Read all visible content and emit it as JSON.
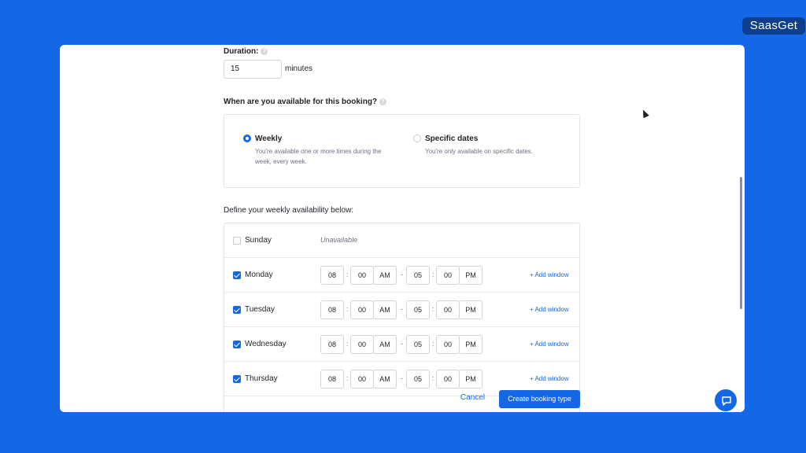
{
  "watermark": "SaasGet",
  "form": {
    "duration_label": "Duration:",
    "duration_value": "15",
    "duration_unit": "minutes",
    "availability_question": "When are you available for this booking?",
    "options": [
      {
        "title": "Weekly",
        "desc": "You're available one or more times during the week, every week.",
        "selected": true
      },
      {
        "title": "Specific dates",
        "desc": "You're only available on specific dates.",
        "selected": false
      }
    ],
    "weekly_label": "Define your weekly availability below:",
    "unavailable_text": "Unavailable",
    "add_window": "+ Add window",
    "days": [
      {
        "name": "Sunday",
        "checked": false
      },
      {
        "name": "Monday",
        "checked": true,
        "start_h": "08",
        "start_m": "00",
        "start_ampm": "AM",
        "end_h": "05",
        "end_m": "00",
        "end_ampm": "PM"
      },
      {
        "name": "Tuesday",
        "checked": true,
        "start_h": "08",
        "start_m": "00",
        "start_ampm": "AM",
        "end_h": "05",
        "end_m": "00",
        "end_ampm": "PM"
      },
      {
        "name": "Wednesday",
        "checked": true,
        "start_h": "08",
        "start_m": "00",
        "start_ampm": "AM",
        "end_h": "05",
        "end_m": "00",
        "end_ampm": "PM"
      },
      {
        "name": "Thursday",
        "checked": true,
        "start_h": "08",
        "start_m": "00",
        "start_ampm": "AM",
        "end_h": "05",
        "end_m": "00",
        "end_ampm": "PM"
      }
    ],
    "time_colon": ":",
    "time_dash": "-"
  },
  "footer": {
    "cancel_label": "Cancel",
    "create_label": "Create booking type"
  },
  "icons": {
    "help": "help-circle-icon",
    "chat": "chat-bubble-icon"
  },
  "colors": {
    "accent": "#1467e5",
    "background": "#1467e5"
  }
}
